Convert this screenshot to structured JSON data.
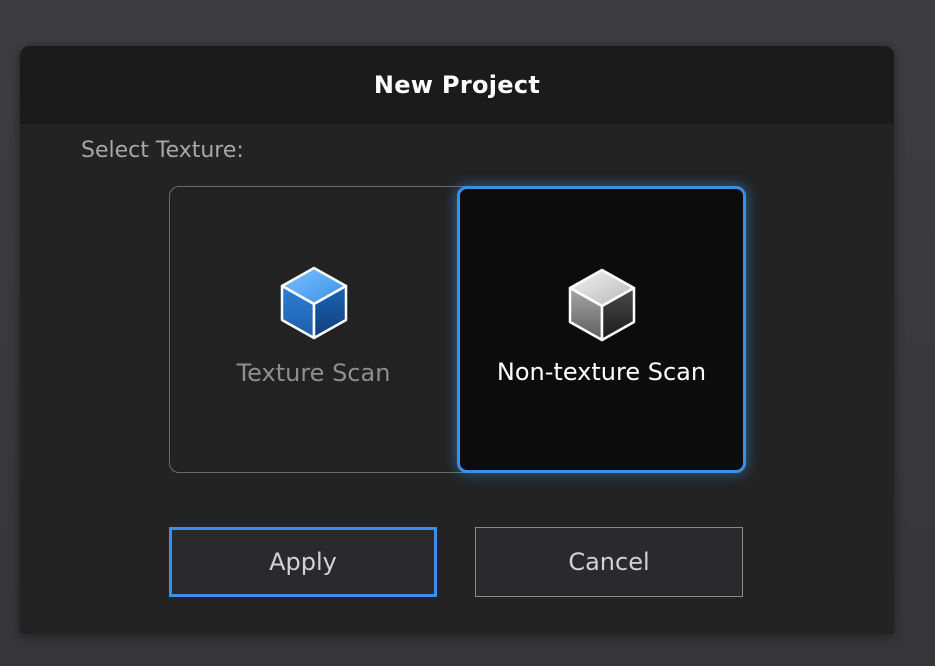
{
  "dialog": {
    "title": "New Project",
    "select_label": "Select Texture:",
    "options": [
      {
        "label": "Texture Scan",
        "icon": "blue-cube-icon",
        "selected": false
      },
      {
        "label": "Non-texture Scan",
        "icon": "gray-cube-icon",
        "selected": true
      }
    ],
    "buttons": {
      "apply_label": "Apply",
      "cancel_label": "Cancel"
    }
  },
  "colors": {
    "accent": "#3a8fe6",
    "dialog_bg": "#232323",
    "header_bg": "#1b1b1b",
    "page_bg": "#3b3b3f"
  }
}
